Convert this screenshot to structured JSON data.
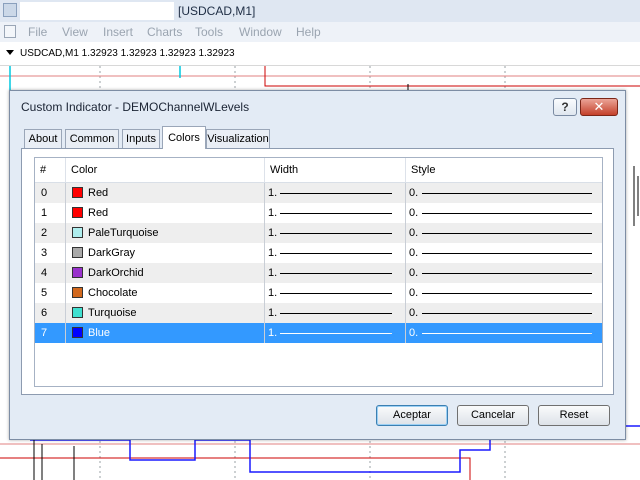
{
  "window": {
    "title": "[USDCAD,M1]"
  },
  "menu": [
    "File",
    "View",
    "Insert",
    "Charts",
    "Tools",
    "Window",
    "Help"
  ],
  "chart": {
    "label": "USDCAD,M1  1.32923 1.32923 1.32923 1.32923"
  },
  "dialog": {
    "title": "Custom Indicator - DEMOChannelWLevels",
    "help_label": "?",
    "close_label": "✕",
    "tabs": [
      {
        "label": "About",
        "active": false
      },
      {
        "label": "Common",
        "active": false
      },
      {
        "label": "Inputs",
        "active": false
      },
      {
        "label": "Colors",
        "active": true
      },
      {
        "label": "Visualization",
        "active": false
      }
    ],
    "columns": [
      "#",
      "Color",
      "Width",
      "Style"
    ],
    "rows": [
      {
        "index": "0",
        "color_name": "Red",
        "swatch": "#ff0000",
        "width": "1.",
        "style": "0."
      },
      {
        "index": "1",
        "color_name": "Red",
        "swatch": "#ff0000",
        "width": "1.",
        "style": "0."
      },
      {
        "index": "2",
        "color_name": "PaleTurquoise",
        "swatch": "#afeeee",
        "width": "1.",
        "style": "0."
      },
      {
        "index": "3",
        "color_name": "DarkGray",
        "swatch": "#a9a9a9",
        "width": "1.",
        "style": "0."
      },
      {
        "index": "4",
        "color_name": "DarkOrchid",
        "swatch": "#9932cc",
        "width": "1.",
        "style": "0."
      },
      {
        "index": "5",
        "color_name": "Chocolate",
        "swatch": "#d2691e",
        "width": "1.",
        "style": "0."
      },
      {
        "index": "6",
        "color_name": "Turquoise",
        "swatch": "#40e0d0",
        "width": "1.",
        "style": "0."
      },
      {
        "index": "7",
        "color_name": "Blue",
        "swatch": "#0000ff",
        "width": "1.",
        "style": "0.",
        "selected": true
      }
    ],
    "buttons": {
      "ok": "Aceptar",
      "cancel": "Cancelar",
      "reset": "Reset"
    }
  },
  "colors": {
    "selection": "#3399ff",
    "chart_red": "#cc0000",
    "chart_blue": "#1a1aff",
    "chart_cyan": "#00c8e0"
  }
}
